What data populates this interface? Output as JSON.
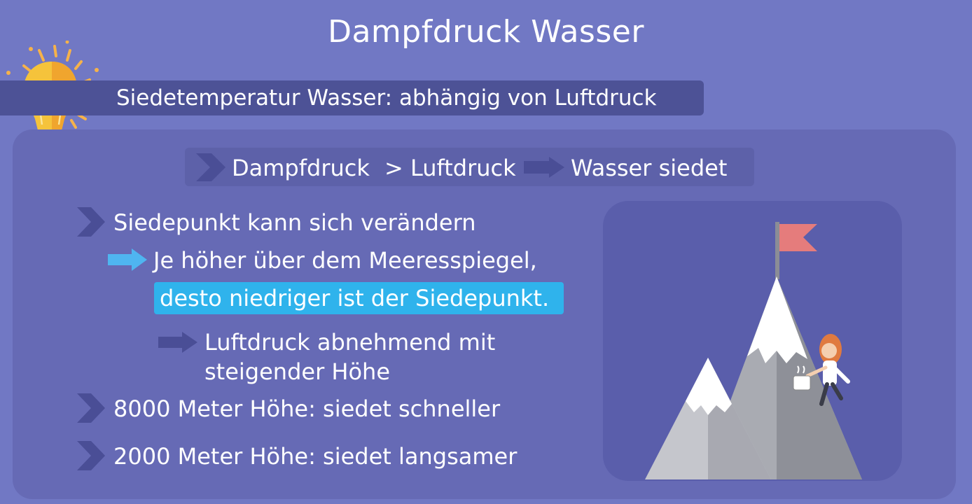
{
  "header": {
    "title": "Dampfdruck Wasser"
  },
  "topic": {
    "text": "Siedetemperatur Wasser: abhängig von Luftdruck"
  },
  "rule": {
    "part1": "Dampfdruck",
    "part2": "> Luftdruck",
    "part3": "Wasser siedet"
  },
  "points": {
    "p1": "Siedepunkt kann sich verändern",
    "p1_sub_line1": "Je höher über dem Meeresspiegel,",
    "p1_sub_line2": "desto niedriger ist der Siedepunkt.",
    "p1_sub2_line1": "Luftdruck abnehmend mit",
    "p1_sub2_line2": "steigender Höhe",
    "p2": "8000 Meter Höhe: siedet schneller",
    "p3": "2000 Meter Höhe: siedet langsamer"
  },
  "icons": {
    "bulb": "lightbulb-icon",
    "chevron": "chevron-right-icon",
    "arrow": "arrow-right-icon"
  },
  "colors": {
    "background": "#7178c4",
    "panel": "#666ab5",
    "highlight": "#2fb3ec",
    "accent_arrow": "#4fb5f0",
    "flag": "#e57c7c"
  }
}
